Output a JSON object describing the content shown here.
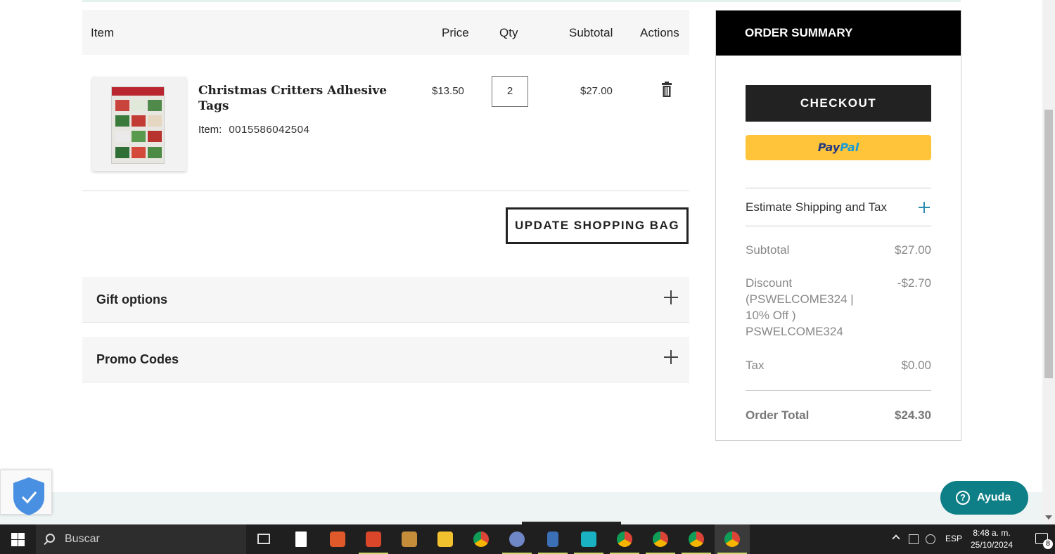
{
  "table": {
    "headers": {
      "item": "Item",
      "price": "Price",
      "qty": "Qty",
      "subtotal": "Subtotal",
      "actions": "Actions"
    },
    "rows": [
      {
        "name": "Christmas Critters Adhesive Tags",
        "item_label": "Item:",
        "item_number": "0015586042504",
        "price": "$13.50",
        "qty": "2",
        "subtotal": "$27.00",
        "action_icon": "trash-icon"
      }
    ]
  },
  "update_button": "UPDATE SHOPPING BAG",
  "accordions": {
    "gift": "Gift options",
    "promo": "Promo Codes"
  },
  "summary": {
    "title": "ORDER SUMMARY",
    "checkout": "CHECKOUT",
    "paypal_a": "Pay",
    "paypal_b": "Pal",
    "estimate": "Estimate Shipping and Tax",
    "subtotal_label": "Subtotal",
    "subtotal_value": "$27.00",
    "discount_label_1": "Discount",
    "discount_label_2": "(PSWELCOME324 |",
    "discount_label_3": "10% Off )",
    "discount_label_4": "PSWELCOME324",
    "discount_value": "-$2.70",
    "tax_label": "Tax",
    "tax_value": "$0.00",
    "total_label": "Order Total",
    "total_value": "$24.30"
  },
  "help_button": "Ayuda",
  "taskbar": {
    "search_placeholder": "Buscar",
    "language": "ESP",
    "time": "8:48 a. m.",
    "date": "25/10/2024",
    "notification_count": "8"
  },
  "colors": {
    "accent": "#0e7f86",
    "paypal": "#ffc439",
    "checkout": "#222222"
  }
}
